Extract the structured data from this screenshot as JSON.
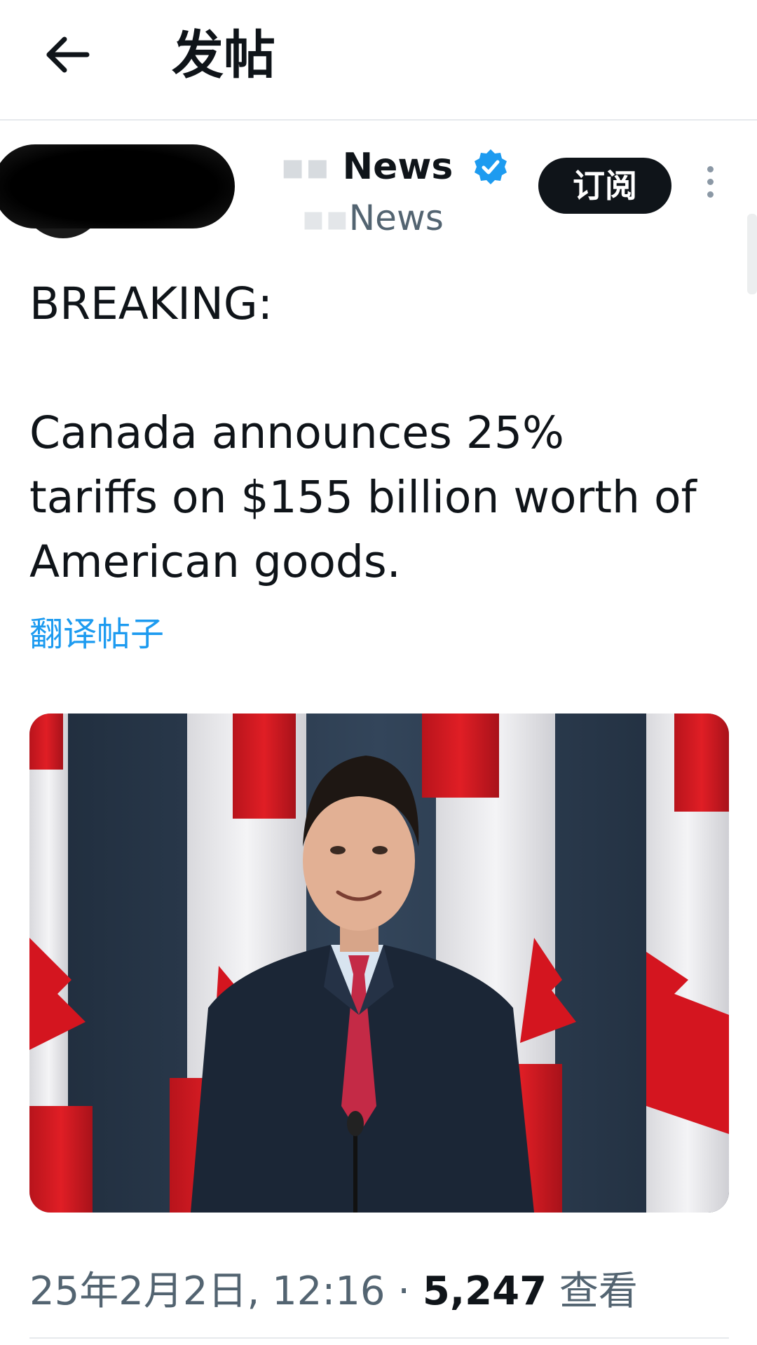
{
  "header": {
    "title": "发帖",
    "back_icon": "arrow-left-icon"
  },
  "author": {
    "name_partial": "News",
    "handle_partial": "News",
    "verified_color": "#1d9bf0",
    "subscribe_label": "订阅",
    "more_icon": "more-vertical-icon"
  },
  "post": {
    "line1": "BREAKING:",
    "line2": "Canada announces 25%",
    "line3": "tariffs on $155 billion worth of",
    "line4": "American goods.",
    "translate_label": "翻译帖子"
  },
  "meta": {
    "datetime": "25年2月2日, 12:16",
    "separator": " · ",
    "views_count": "5,247",
    "views_label": "查看"
  },
  "colors": {
    "accent": "#1d9bf0",
    "text": "#0f1419",
    "muted": "#536471"
  }
}
